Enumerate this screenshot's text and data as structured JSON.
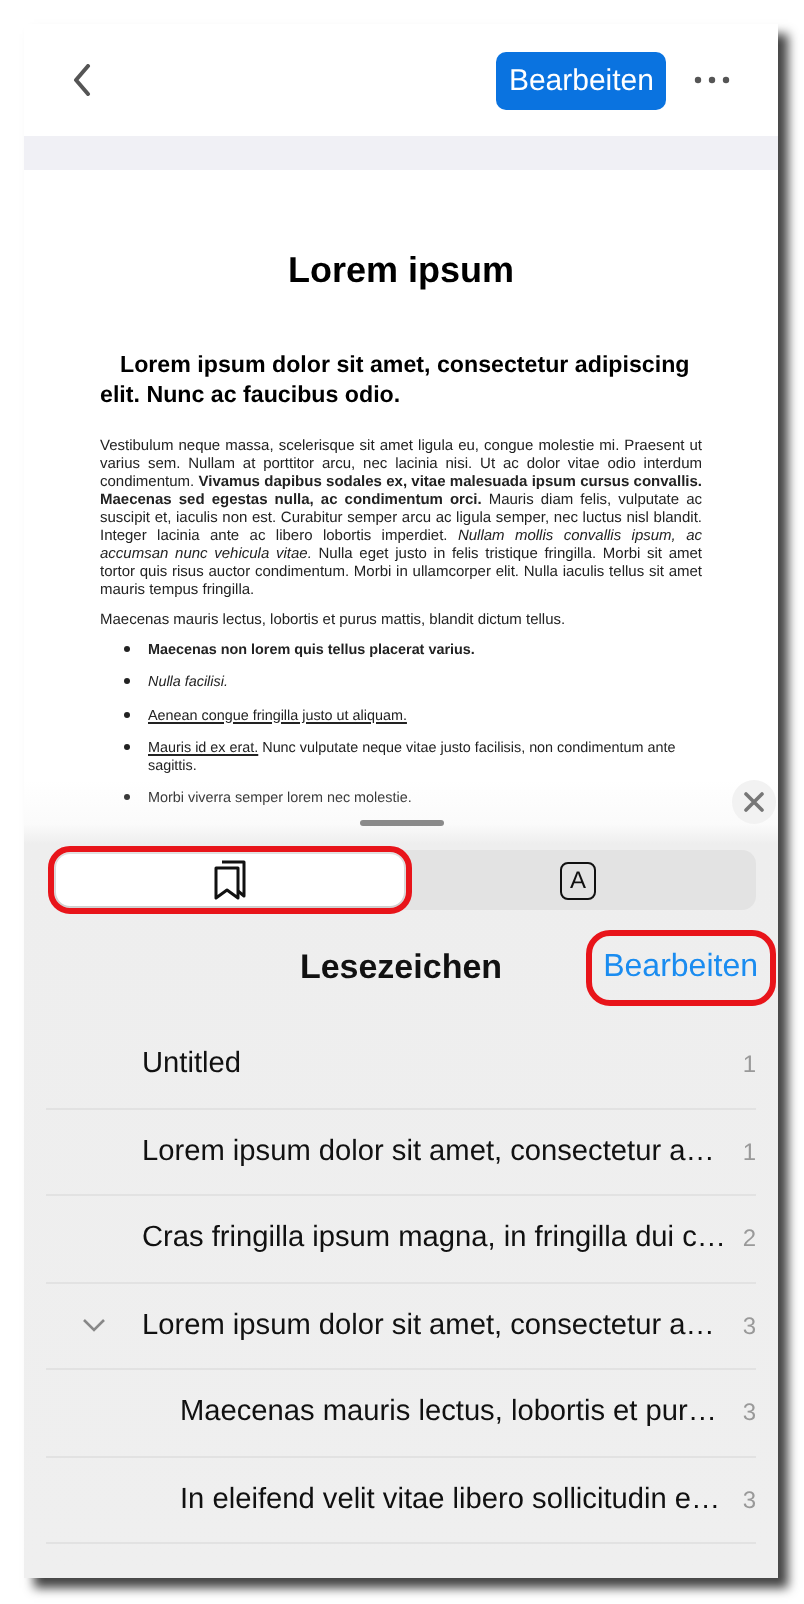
{
  "nav": {
    "edit_button": "Bearbeiten"
  },
  "document": {
    "title": "Lorem ipsum",
    "heading": "Lorem ipsum dolor sit amet, consectetur adipiscing elit. Nunc ac faucibus odio.",
    "paragraphs": [
      "Vestibulum neque massa, scelerisque sit amet ligula eu, congue molestie mi. Praesent ut varius sem. Nullam at porttitor arcu, nec lacinia nisi. Ut ac dolor vitae odio interdum condimentum. **Vivamus dapibus sodales ex, vitae malesuada ipsum cursus convallis. Maecenas sed egestas nulla, ac condimentum orci.** Mauris diam felis, vulputate ac suscipit et, iaculis non est. Curabitur semper arcu ac ligula semper, nec luctus nisl blandit. Integer lacinia ante ac libero lobortis imperdiet. *Nullam mollis convallis ipsum, ac accumsan nunc vehicula vitae.* Nulla eget justo in felis tristique fringilla. Morbi sit amet tortor quis risus auctor condimentum. Morbi in ullamcorper elit. Nulla iaculis tellus sit amet mauris tempus fringilla.",
      "Maecenas mauris lectus, lobortis et purus mattis, blandit dictum tellus."
    ],
    "bullets": [
      {
        "kind": "bold",
        "text": "Maecenas non lorem quis tellus placerat varius."
      },
      {
        "kind": "italic",
        "text": "Nulla facilisi."
      },
      {
        "kind": "underline",
        "text": "Aenean congue fringilla justo ut aliquam."
      },
      {
        "kind": "plain",
        "link": "Mauris id ex erat.",
        "text": "Nunc vulputate neque vitae justo facilisis, non condimentum ante sagittis."
      },
      {
        "kind": "plain",
        "text": "Morbi viverra semper lorem nec molestie."
      }
    ]
  },
  "sheet": {
    "tabs": [
      {
        "kind": "bookmarks",
        "selected": true,
        "highlighted": true
      },
      {
        "kind": "text",
        "label": "A",
        "selected": false,
        "highlighted": false
      }
    ],
    "title": "Lesezeichen",
    "edit_button": {
      "label": "Bearbeiten",
      "highlighted": true
    },
    "bookmarks": [
      {
        "title": "Untitled",
        "page": "1"
      },
      {
        "title": "Lorem ipsum dolor sit amet, consectetur a…",
        "page": "1"
      },
      {
        "title": "Cras fringilla ipsum magna, in fringilla dui c…",
        "page": "2"
      },
      {
        "title": "Lorem ipsum dolor sit amet, consectetur a…",
        "page": "3",
        "expanded": true,
        "children": [
          {
            "title": "Maecenas mauris lectus, lobortis et pur…",
            "page": "3"
          },
          {
            "title": "In eleifend velit vitae libero sollicitudin e…",
            "page": "3"
          }
        ]
      }
    ]
  }
}
